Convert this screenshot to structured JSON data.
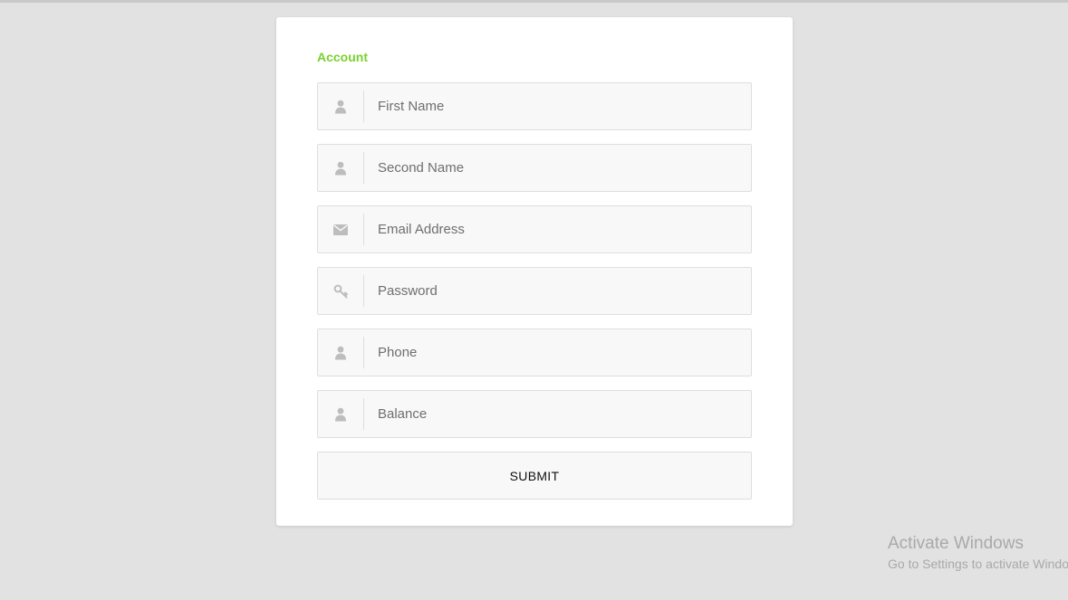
{
  "form": {
    "section_title": "Account",
    "accent_color": "#79d12a",
    "fields": [
      {
        "name": "first-name",
        "icon": "user-icon",
        "placeholder": "First Name",
        "value": ""
      },
      {
        "name": "second-name",
        "icon": "user-icon",
        "placeholder": "Second Name",
        "value": ""
      },
      {
        "name": "email-address",
        "icon": "envelope-icon",
        "placeholder": "Email Address",
        "value": ""
      },
      {
        "name": "password",
        "icon": "key-icon",
        "placeholder": "Password",
        "value": ""
      },
      {
        "name": "phone",
        "icon": "user-icon",
        "placeholder": "Phone",
        "value": ""
      },
      {
        "name": "balance",
        "icon": "user-icon",
        "placeholder": "Balance",
        "value": ""
      }
    ],
    "submit_label": "SUBMIT"
  },
  "watermark": {
    "title": "Activate Windows",
    "subtitle": "Go to Settings to activate Windows."
  }
}
